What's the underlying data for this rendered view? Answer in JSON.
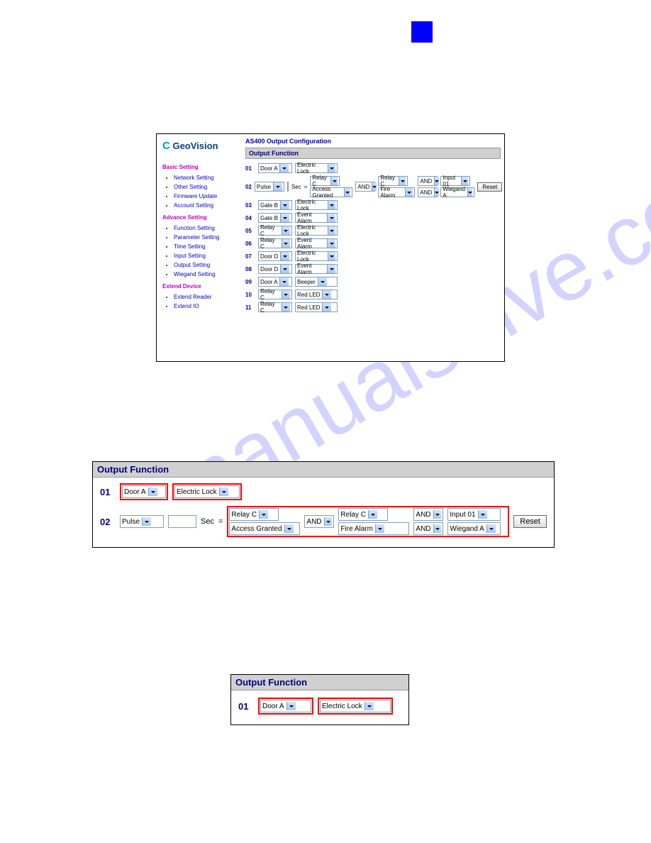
{
  "watermark": "manualshive.com",
  "panel1": {
    "logo": "GeoVision",
    "title": "AS400 Output Configuration",
    "section_header": "Output Function",
    "sidebar": {
      "basic": {
        "head": "Basic Setting",
        "items": [
          "Network Setting",
          "Other Setting",
          "Firmware Update",
          "Account Setting"
        ]
      },
      "advance": {
        "head": "Advance Setting",
        "items": [
          "Function Setting",
          "Parameter Setting",
          "Time Setting",
          "Input Setting",
          "Output Setting",
          "Wiegand Setting"
        ]
      },
      "extend": {
        "head": "Extend Device",
        "items": [
          "Extend Reader",
          "Extend IO"
        ]
      }
    },
    "rows": [
      {
        "n": "01",
        "a": "Door A",
        "b": "Electric Lock"
      },
      {
        "n": "02",
        "a": "Pulse",
        "sec": "Sec",
        "eq": "=",
        "c1": "Relay C",
        "c2": "Access Granted",
        "and1": "AND",
        "d1": "Relay C",
        "d2": "Fire Alarm",
        "and2": "AND",
        "and3": "AND",
        "e1": "Input 01",
        "e2": "Wiegand A",
        "reset": "Reset"
      },
      {
        "n": "03",
        "a": "Gate B",
        "b": "Electric Lock"
      },
      {
        "n": "04",
        "a": "Gate B",
        "b": "Event Alarm"
      },
      {
        "n": "05",
        "a": "Relay C",
        "b": "Electric Lock"
      },
      {
        "n": "06",
        "a": "Relay C",
        "b": "Event Alarm"
      },
      {
        "n": "07",
        "a": "Door D",
        "b": "Electric Lock"
      },
      {
        "n": "08",
        "a": "Door D",
        "b": "Event Alarm"
      },
      {
        "n": "09",
        "a": "Door A",
        "b": "Beeper"
      },
      {
        "n": "10",
        "a": "Relay C",
        "b": "Red LED"
      },
      {
        "n": "11",
        "a": "Relay C",
        "b": "Red LED"
      }
    ]
  },
  "panel2": {
    "header": "Output Function",
    "row1": {
      "n": "01",
      "a": "Door A",
      "b": "Electric Lock"
    },
    "row2": {
      "n": "02",
      "a": "Pulse",
      "sec": "Sec",
      "eq": "=",
      "c1": "Relay C",
      "c2": "Access Granted",
      "and1": "AND",
      "d1": "Relay C",
      "d2": "Fire Alarm",
      "and2": "AND",
      "and3": "AND",
      "e1": "Input 01",
      "e2": "Wiegand A",
      "reset": "Reset"
    }
  },
  "panel3": {
    "header": "Output Function",
    "row": {
      "n": "01",
      "a": "Door A",
      "b": "Electric Lock"
    }
  }
}
